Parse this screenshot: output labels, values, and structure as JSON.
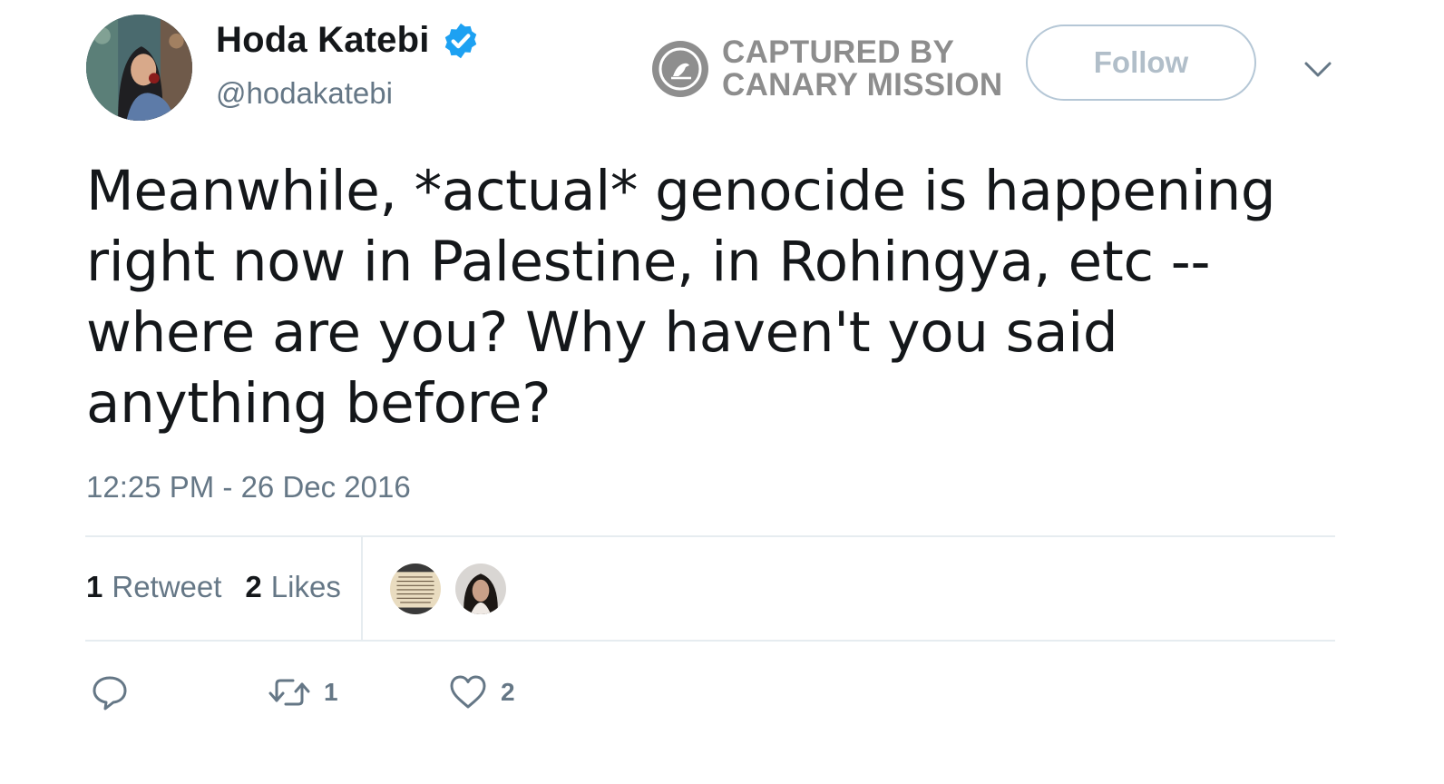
{
  "author": {
    "display_name": "Hoda Katebi",
    "handle": "@hodakatebi",
    "verified": true,
    "verified_color": "#1da1f2"
  },
  "watermark": {
    "line1": "CAPTURED BY",
    "line2": "CANARY MISSION"
  },
  "follow_button": {
    "label": "Follow"
  },
  "tweet": {
    "text": "Meanwhile, *actual* genocide is happening\nright now in Palestine, in Rohingya, etc --\nwhere are you? Why haven't you said\nanything before?",
    "timestamp": "12:25 PM - 26 Dec 2016"
  },
  "stats": {
    "retweets_count": "1",
    "retweets_label": "Retweet",
    "likes_count": "2",
    "likes_label": "Likes"
  },
  "actions": {
    "reply_icon": "reply-icon",
    "retweet_icon": "retweet-icon",
    "retweet_count": "1",
    "like_icon": "heart-icon",
    "like_count": "2"
  },
  "colors": {
    "text_primary": "#14171a",
    "text_secondary": "#657786",
    "divider": "#e6ecf0",
    "follow_border": "#b5c7d6",
    "watermark": "#8d8d8d"
  }
}
